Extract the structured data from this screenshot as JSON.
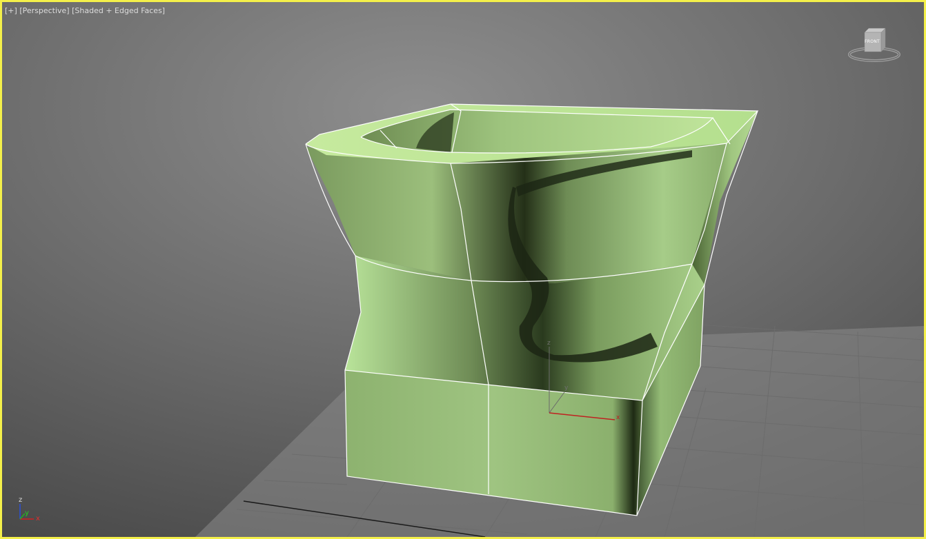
{
  "viewport": {
    "label_plus": "[+]",
    "label_view": "[Perspective]",
    "label_shading": "[Shaded + Edged Faces]",
    "border_color": "#f4f04a"
  },
  "viewcube": {
    "face_label": "FRONT",
    "icon": "viewcube-icon"
  },
  "world_axis": {
    "z": "z",
    "y": "y",
    "x": "x"
  },
  "gizmo": {
    "z": "z",
    "y": "y",
    "x": "x"
  },
  "colors": {
    "object_green": "#a8d98c",
    "edge_white": "#ffffff",
    "axis_x": "#d22020",
    "axis_y": "#20b020",
    "axis_z": "#2a50d8"
  }
}
